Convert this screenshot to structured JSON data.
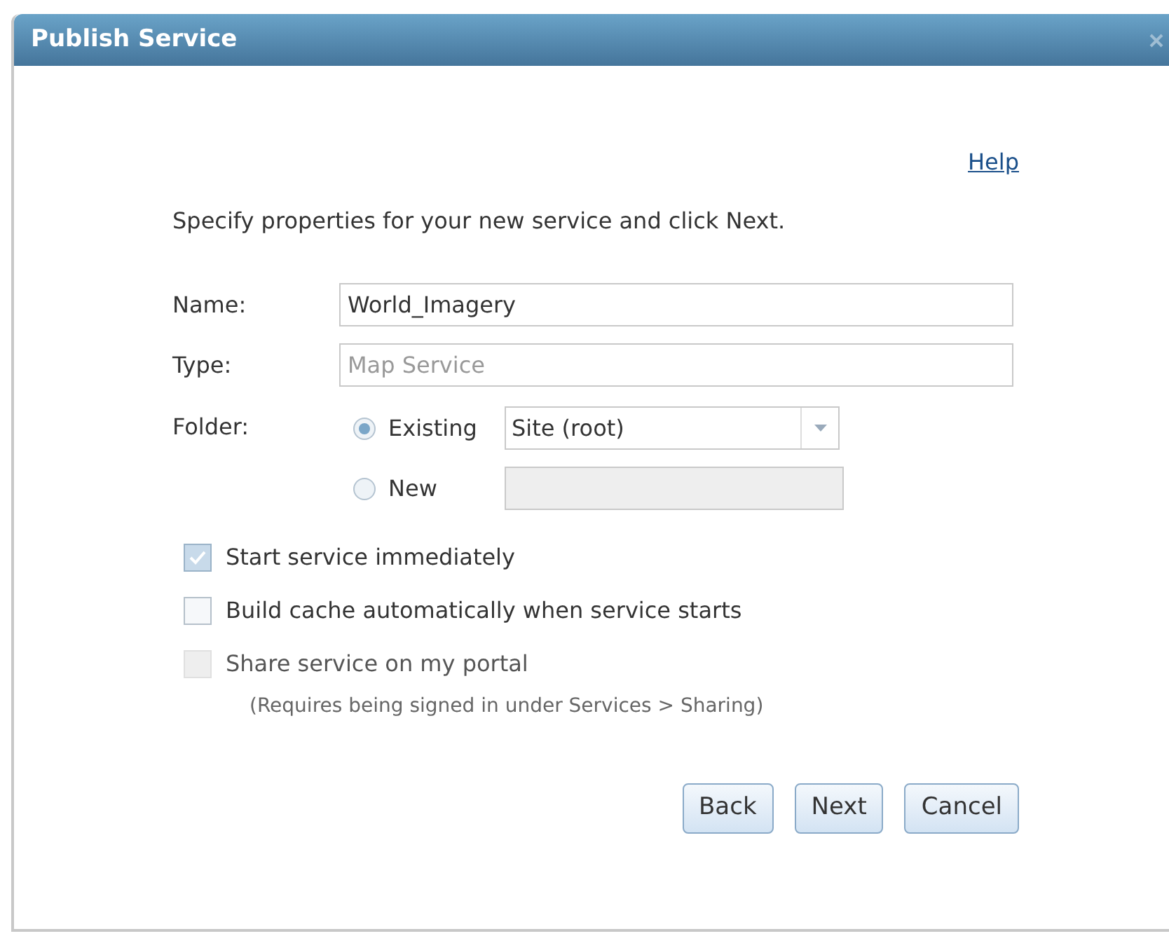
{
  "window": {
    "title": "Publish Service"
  },
  "help_link": "Help",
  "instruction": "Specify properties for your new service and click Next.",
  "fields": [
    {
      "label": "Name:",
      "value": "World_Imagery",
      "disabled": false
    },
    {
      "label": "Type:",
      "value": "Map Service",
      "disabled": true
    }
  ],
  "folder": {
    "label": "Folder:",
    "options": [
      {
        "kind": "dropdown",
        "label": "Existing",
        "selected": true,
        "value": "Site (root)"
      },
      {
        "kind": "text",
        "label": "New",
        "selected": false,
        "disabled": true
      }
    ]
  },
  "checkboxes": [
    {
      "label": "Start service immediately",
      "checked": true,
      "disabled": false
    },
    {
      "label": "Build cache automatically when service starts",
      "checked": false,
      "disabled": false
    },
    {
      "label": "Share service on my portal",
      "checked": false,
      "disabled": true,
      "note": "(Requires being signed in under Services > Sharing)"
    }
  ],
  "buttons": [
    "Back",
    "Next",
    "Cancel"
  ]
}
